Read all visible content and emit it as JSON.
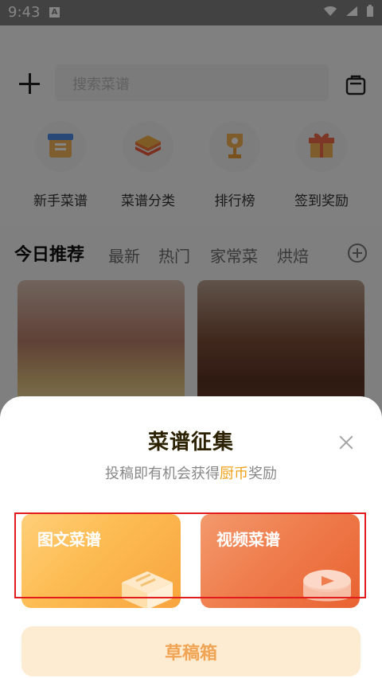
{
  "status_bar": {
    "time": "9:43",
    "indicator": "A"
  },
  "header": {
    "search_placeholder": "搜索菜谱"
  },
  "quick_links": [
    {
      "label": "新手菜谱",
      "icon": "beginner-recipe-icon"
    },
    {
      "label": "菜谱分类",
      "icon": "recipe-category-icon"
    },
    {
      "label": "排行榜",
      "icon": "ranking-trophy-icon"
    },
    {
      "label": "签到奖励",
      "icon": "checkin-gift-icon"
    }
  ],
  "tabs": [
    {
      "label": "今日推荐",
      "active": true
    },
    {
      "label": "最新"
    },
    {
      "label": "热门"
    },
    {
      "label": "家常菜"
    },
    {
      "label": "烘焙"
    }
  ],
  "sheet": {
    "title": "菜谱征集",
    "subtitle_prefix": "投稿即有机会获得",
    "subtitle_highlight": "厨币",
    "subtitle_suffix": "奖励",
    "options": [
      {
        "label": "图文菜谱"
      },
      {
        "label": "视频菜谱"
      }
    ],
    "draft_label": "草稿箱"
  },
  "colors": {
    "accent": "#f0a11a",
    "highlight_box": "#e21c1c",
    "draft_bg": "#fdebd2"
  }
}
